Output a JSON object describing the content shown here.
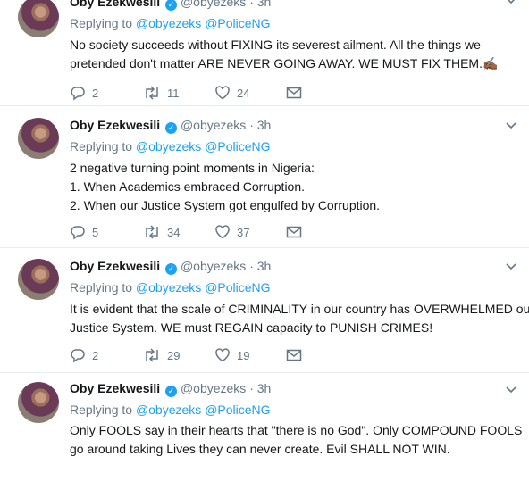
{
  "tweets": [
    {
      "name": "Oby Ezekwesili",
      "handle": "@obyezeks",
      "time": "3h",
      "replying_prefix": "Replying to",
      "mentions": [
        "@obyezeks",
        "@PoliceNG"
      ],
      "lines": [
        "No society succeeds without FIXING its severest ailment. All the things we",
        "pretended don't matter ARE NEVER GOING AWAY. WE MUST FIX THEM.✍🏾"
      ],
      "replies": "2",
      "retweets": "11",
      "likes": "24"
    },
    {
      "name": "Oby Ezekwesili",
      "handle": "@obyezeks",
      "time": "3h",
      "replying_prefix": "Replying to",
      "mentions": [
        "@obyezeks",
        "@PoliceNG"
      ],
      "lines": [
        "2 negative turning point moments in Nigeria:",
        "1. When Academics  embraced Corruption.",
        "2. When our Justice System got engulfed by Corruption."
      ],
      "replies": "5",
      "retweets": "34",
      "likes": "37"
    },
    {
      "name": "Oby Ezekwesili",
      "handle": "@obyezeks",
      "time": "3h",
      "replying_prefix": "Replying to",
      "mentions": [
        "@obyezeks",
        "@PoliceNG"
      ],
      "lines": [
        "It is evident that the scale of CRIMINALITY in our country has OVERWHELMED our",
        "Justice System. WE must REGAIN capacity to  PUNISH CRIMES!"
      ],
      "replies": "2",
      "retweets": "29",
      "likes": "19"
    },
    {
      "name": "Oby Ezekwesili",
      "handle": "@obyezeks",
      "time": "3h",
      "replying_prefix": "Replying to",
      "mentions": [
        "@obyezeks",
        "@PoliceNG"
      ],
      "lines": [
        "Only FOOLS say in their hearts that \"there is no God\". Only COMPOUND FOOLS",
        "go around taking Lives they can never create. Evil SHALL NOT WIN."
      ],
      "replies": "",
      "retweets": "",
      "likes": ""
    }
  ],
  "icons": {
    "reply": "reply-icon",
    "retweet": "retweet-icon",
    "like": "heart-icon",
    "dm": "envelope-icon",
    "verified": "verified-badge-icon",
    "more": "chevron-down-icon"
  },
  "colors": {
    "link": "#1da1f2",
    "meta": "#657786",
    "text": "#14171a",
    "divider": "#e6ecf0"
  }
}
